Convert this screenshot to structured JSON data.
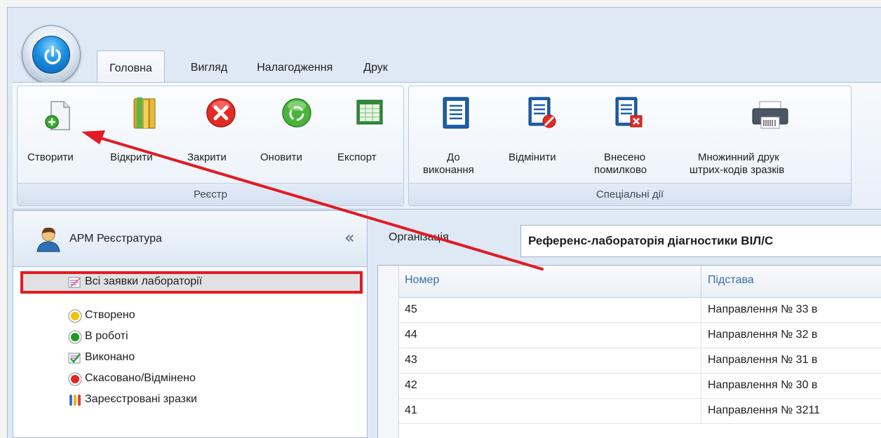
{
  "tabs": [
    "Головна",
    "Вигляд",
    "Налагодження",
    "Друк"
  ],
  "ribbon": {
    "registry_group": {
      "caption": "Реєстр",
      "buttons": [
        "Створити",
        "Відкрити",
        "Закрити",
        "Оновити",
        "Експорт"
      ]
    },
    "special_group": {
      "caption": "Спеціальні дії",
      "buttons": [
        {
          "line1": "До",
          "line2": "виконання"
        },
        {
          "line1": "Відмінити",
          "line2": ""
        },
        {
          "line1": "Внесено",
          "line2": "помилково"
        },
        {
          "line1": "Множинний друк",
          "line2": "штрих-кодів зразків"
        }
      ]
    }
  },
  "nav": {
    "title": "АРМ Реєстратура",
    "collapse": "«",
    "items": [
      {
        "label": "Всі заявки лабораторії",
        "icon": "all-requests-icon"
      },
      {
        "label": "Створено",
        "icon": "yellow-status-icon",
        "color": "#f2c200"
      },
      {
        "label": "В роботі",
        "icon": "green-status-icon",
        "color": "#1f9c1f"
      },
      {
        "label": "Виконано",
        "icon": "completed-icon"
      },
      {
        "label": "Скасовано/Відмінено",
        "icon": "red-status-icon",
        "color": "#e0261f"
      },
      {
        "label": "Зареєстровані зразки",
        "icon": "test-tubes-icon"
      }
    ]
  },
  "filter": {
    "label": "Організація",
    "value": "Референс-лабораторія діагностики ВІЛ/С"
  },
  "grid": {
    "columns": [
      "Номер",
      "Підстава"
    ],
    "rows": [
      [
        "45",
        "Направлення № 33 в"
      ],
      [
        "44",
        "Направлення № 32 в"
      ],
      [
        "43",
        "Направлення № 31 в"
      ],
      [
        "42",
        "Направлення № 30 в"
      ],
      [
        "41",
        "Направлення № 3211"
      ]
    ]
  },
  "annotation": {
    "arrow_color": "#e11b22"
  }
}
